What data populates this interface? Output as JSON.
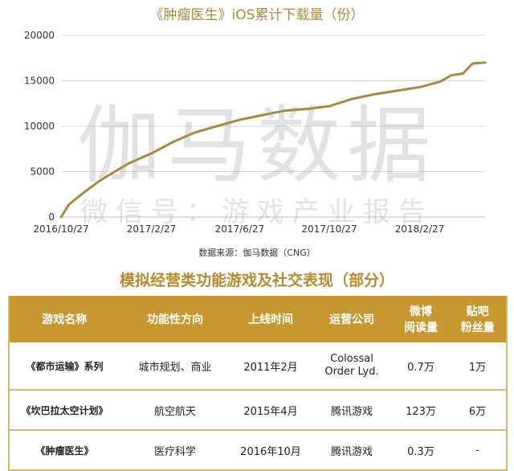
{
  "chart_data": {
    "type": "line",
    "title": "《肿瘤医生》iOS累计下载量（份）",
    "x_tick_labels": [
      "2016/10/27",
      "2017/2/27",
      "2017/6/27",
      "2017/10/27",
      "2018/2/27"
    ],
    "y_tick_labels": [
      "0",
      "5000",
      "10000",
      "15000",
      "20000"
    ],
    "ylim": [
      0,
      20000
    ],
    "xlim": [
      "2016-10-27",
      "2018-05-27"
    ],
    "grid": true,
    "line_color": "#a88a3a",
    "series": [
      {
        "x": [
          "2016-10-27",
          "2016-11-07",
          "2016-11-27",
          "2016-12-17",
          "2017-01-06",
          "2017-01-27",
          "2017-02-27",
          "2017-03-27",
          "2017-04-27",
          "2017-05-27",
          "2017-06-27",
          "2017-07-27",
          "2017-08-27",
          "2017-09-27",
          "2017-10-27",
          "2017-11-27",
          "2017-12-27",
          "2018-01-27",
          "2018-02-27",
          "2018-03-27",
          "2018-04-11",
          "2018-04-27",
          "2018-05-10",
          "2018-05-27"
        ],
        "values": [
          0,
          1400,
          2700,
          3900,
          4900,
          5900,
          7000,
          8200,
          9300,
          10000,
          10700,
          11200,
          11700,
          11900,
          12200,
          13000,
          13500,
          13900,
          14300,
          14900,
          15600,
          15800,
          16900,
          17000
        ]
      }
    ]
  },
  "watermark": {
    "main": "伽马数据",
    "sub": "微信号：游戏产业报告"
  },
  "source": "数据来源：伽马数据（CNG）",
  "table": {
    "title": "模拟经营类功能游戏及社交表现（部分）",
    "headers": [
      "游戏名称",
      "功能性方向",
      "上线时间",
      "运营公司",
      "微博\n阅读量",
      "贴吧\n粉丝量"
    ],
    "rows": [
      [
        "《都市运输》系列",
        "城市规划、商业",
        "2011年2月",
        "Colossal\nOrder Lyd.",
        "0.7万",
        "1万"
      ],
      [
        "《坎巴拉太空计划》",
        "航空航天",
        "2015年4月",
        "腾讯游戏",
        "123万",
        "6万"
      ],
      [
        "《肿瘤医生》",
        "医疗科学",
        "2016年10月",
        "腾讯游戏",
        "0.3万",
        "-"
      ]
    ]
  }
}
